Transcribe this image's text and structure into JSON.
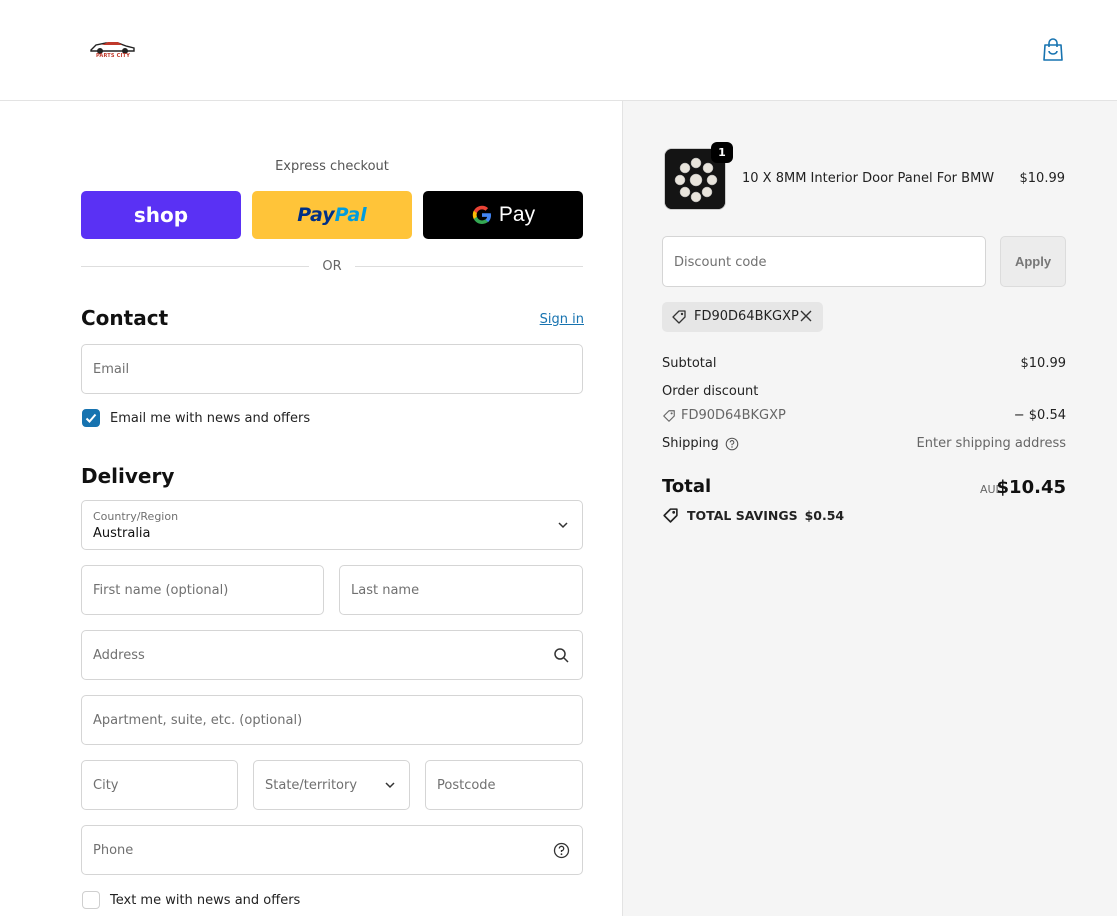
{
  "header": {
    "logo_text": "PARTS CITY",
    "cart_icon": "shopping-bag-icon"
  },
  "express": {
    "label": "Express checkout",
    "shop_label": "shop",
    "paypal_label_1": "Pay",
    "paypal_label_2": "Pal",
    "gpay_label": "Pay",
    "or_text": "OR"
  },
  "contact": {
    "title": "Contact",
    "signin_label": "Sign in",
    "email_placeholder": "Email",
    "news_label": "Email me with news and offers",
    "news_checked": true
  },
  "delivery": {
    "title": "Delivery",
    "country_label": "Country/Region",
    "country_value": "Australia",
    "first_name_placeholder": "First name (optional)",
    "last_name_placeholder": "Last name",
    "address_placeholder": "Address",
    "apartment_placeholder": "Apartment, suite, etc. (optional)",
    "city_placeholder": "City",
    "state_placeholder": "State/territory",
    "postcode_placeholder": "Postcode",
    "phone_placeholder": "Phone",
    "text_label": "Text me with news and offers",
    "text_checked": false
  },
  "summary": {
    "product_name": "10 X 8MM Interior Door Panel For BMW",
    "product_price": "$10.99",
    "quantity": "1",
    "discount_placeholder": "Discount code",
    "apply_label": "Apply",
    "applied_code": "FD90D64BKGXP",
    "subtotal_label": "Subtotal",
    "subtotal_value": "$10.99",
    "order_discount_label": "Order discount",
    "discount_code": "FD90D64BKGXP",
    "discount_value": "− $0.54",
    "shipping_label": "Shipping",
    "shipping_value": "Enter shipping address",
    "total_label": "Total",
    "currency": "AUD",
    "total_value": "$10.45",
    "savings_label": "TOTAL SAVINGS",
    "savings_value": "$0.54"
  },
  "colors": {
    "shop_purple": "#5a31f4",
    "paypal_yellow": "#ffc439",
    "link_blue": "#1773b0"
  }
}
